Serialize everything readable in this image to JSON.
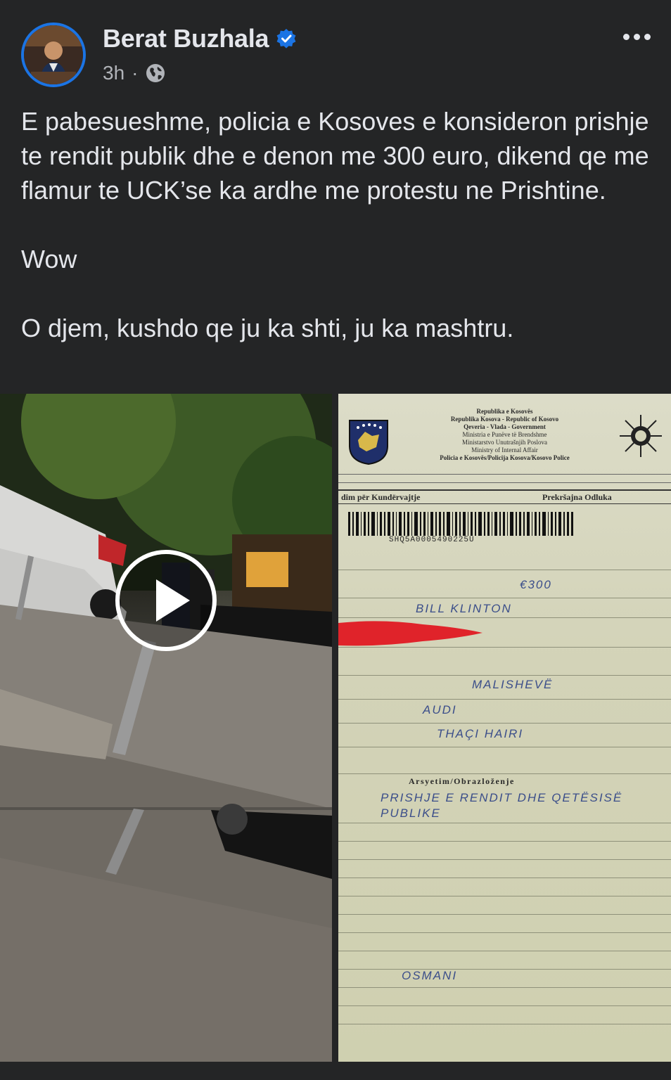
{
  "author": {
    "name": "Berat Buzhala",
    "verified": true,
    "time": "3h",
    "audience_icon": "globe-icon"
  },
  "more_icon": "more-options-icon",
  "post": {
    "paragraph_1": "E pabesueshme, policia e Kosoves e konsideron prishje te rendit publik dhe e denon me 300 euro, dikend qe me flamur te UCK’se ka ardhe me protestu ne Prishtine.",
    "paragraph_2": "Wow",
    "paragraph_3": "O djem, kushdo qe ju ka shti, ju ka mashtru."
  },
  "media": {
    "video_icon": "play-icon",
    "ticket": {
      "header_1": "Republika e Kosovës",
      "header_2": "Republika Kosova - Republic of Kosovo",
      "header_3": "Qeveria - Vlada - Government",
      "header_4": "Ministria e Punëve të Brendshme",
      "header_5": "Ministarstvo Unutrašnjih Poslova",
      "header_6": "Ministry of Internal Affair",
      "header_7": "Policia e Kosovës/Policija Kosova/Kosovo Police",
      "left_title": "dim për Kundërvajtje",
      "right_title": "Prekršajna Odluka",
      "barcode_number": "SHQ5A0005490225U",
      "name_hand": "BILL KLINTON",
      "fine_hand": "€300",
      "place_hand": "MALISHEVË",
      "car_hand": "AUDI",
      "owner_hand": "THAÇI HAIRI",
      "reason_label": "Arsyetim/Obrazloženje",
      "reason_hand": "PRISHJE E RENDIT DHE QETËSISË PUBLIKE",
      "officer_hand": "OSMANI"
    }
  },
  "colors": {
    "background": "#242526",
    "text": "#e4e6eb",
    "muted": "#b0b3b8",
    "verified_blue": "#1b74e4"
  }
}
